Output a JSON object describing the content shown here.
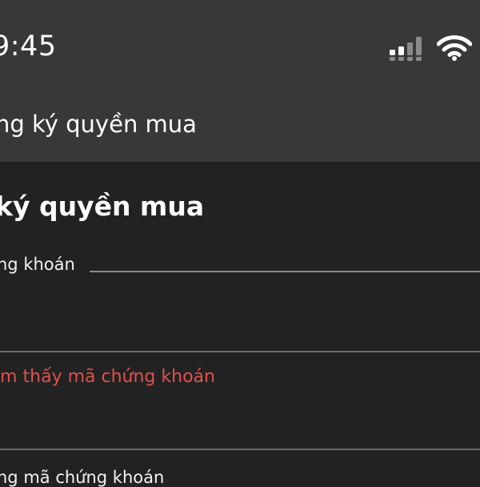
{
  "status_bar": {
    "time": "9:45",
    "signal_icon": "cellular-signal-icon",
    "wifi_icon": "wifi-icon"
  },
  "app_bar": {
    "title": "ng ký quyền mua"
  },
  "main": {
    "heading": "ký quyền mua",
    "stock_field": {
      "label": "ng khoán",
      "value": ""
    },
    "error_message": "ìm thấy mã chứng khoán",
    "next_field_label": "ng mã chứng khoán"
  },
  "colors": {
    "header_bg": "#383838",
    "page_bg": "#222222",
    "error": "#e0504e"
  }
}
